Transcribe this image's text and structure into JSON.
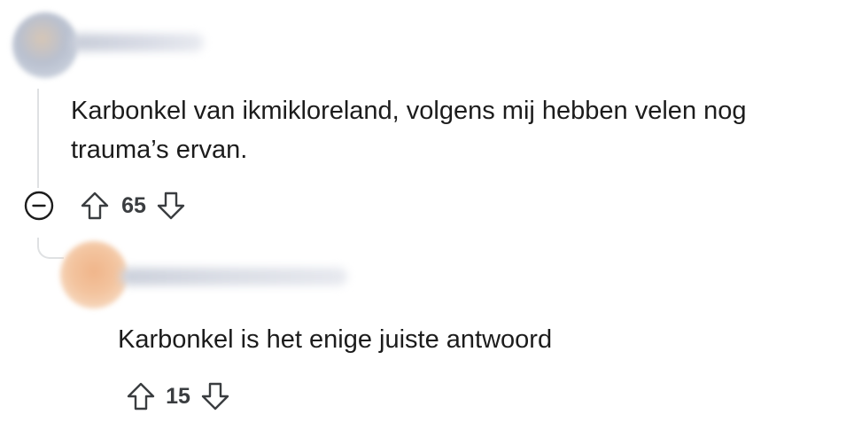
{
  "comments": [
    {
      "text": "Karbonkel van ikmikloreland, volgens mij hebben velen nog trauma’s ervan.",
      "votes": "65",
      "author_blurred": true,
      "avatar_blurred": true,
      "collapse_icon": "minus-circle-icon",
      "upvote_icon": "arrow-up-outline-icon",
      "downvote_icon": "arrow-down-outline-icon"
    },
    {
      "text": "Karbonkel is het enige juiste antwoord",
      "votes": "15",
      "author_blurred": true,
      "avatar_blurred": true,
      "upvote_icon": "arrow-up-outline-icon",
      "downvote_icon": "arrow-down-outline-icon"
    }
  ],
  "colors": {
    "text": "#1c1c1c",
    "vote_count": "#3a3d40",
    "thread_line": "#dfe1e3",
    "icon_stroke": "#3a3d40"
  }
}
